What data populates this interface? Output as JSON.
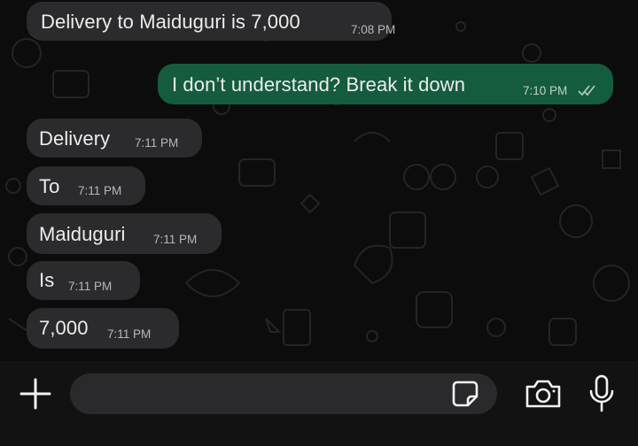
{
  "messages": [
    {
      "direction": "in",
      "text": "Delivery to Maiduguri is 7,000",
      "time": "7:08 PM"
    },
    {
      "direction": "out",
      "text": "I don’t understand? Break it down",
      "time": "7:10 PM",
      "status": "read-double-check"
    },
    {
      "direction": "in",
      "text": "Delivery",
      "time": "7:11 PM"
    },
    {
      "direction": "in",
      "text": "To",
      "time": "7:11 PM"
    },
    {
      "direction": "in",
      "text": "Maiduguri",
      "time": "7:11 PM"
    },
    {
      "direction": "in",
      "text": "Is",
      "time": "7:11 PM"
    },
    {
      "direction": "in",
      "text": "7,000",
      "time": "7:11 PM"
    }
  ],
  "input": {
    "value": "",
    "placeholder": ""
  },
  "icons": {
    "attach": "plus-icon",
    "sticker": "sticker-icon",
    "camera": "camera-icon",
    "voice": "microphone-icon"
  },
  "colors": {
    "incoming_bubble": "#2b2b2d",
    "outgoing_bubble": "#155c3f",
    "background": "#0c0c0c"
  }
}
